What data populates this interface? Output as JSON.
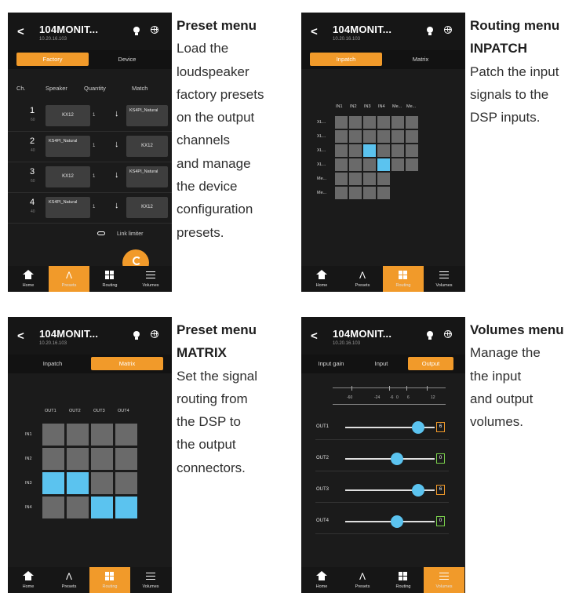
{
  "device": {
    "name": "104MONIT...",
    "ip": "10.20.16.103"
  },
  "nav": [
    "Home",
    "Presets",
    "Routing",
    "Volumes"
  ],
  "icons": {
    "back": "back-chevron-icon",
    "bulb": "bulb-icon",
    "globe": "globe-icon",
    "link": "link-icon",
    "fab": "tools-icon"
  },
  "colors": {
    "accent": "#f19a2a",
    "active_cell": "#5bc3ef",
    "inactive_cell": "#6a6a6a",
    "background": "#1b1b1b"
  },
  "screen1": {
    "tabs": [
      "Factory",
      "Device"
    ],
    "active_tab": 0,
    "headers": {
      "ch": "Ch.",
      "speaker": "Speaker",
      "quantity": "Quantity",
      "match": "Match"
    },
    "rows": [
      {
        "ch": "1",
        "sub": "60",
        "speaker": "KX12",
        "qty": "1",
        "arrow": "↓",
        "match": "KS4PI_Natural"
      },
      {
        "ch": "2",
        "sub": "40",
        "speaker": "KS4PI_Natural",
        "qty": "1",
        "arrow": "↓",
        "match": "KX12"
      },
      {
        "ch": "3",
        "sub": "60",
        "speaker": "KX12",
        "qty": "1",
        "arrow": "↓",
        "match": "KS4PI_Natural"
      },
      {
        "ch": "4",
        "sub": "40",
        "speaker": "KS4PI_Natural",
        "qty": "1",
        "arrow": "↓",
        "match": "KX12"
      }
    ],
    "link_limiter": "Link limiter",
    "active_nav": 1
  },
  "screen2": {
    "tabs": [
      "Inpatch",
      "Matrix"
    ],
    "active_tab": 0,
    "col_labels": [
      "IN1",
      "IN2",
      "IN3",
      "IN4",
      "Me...",
      "Me..."
    ],
    "row_labels": [
      "XL...",
      "XL...",
      "XL...",
      "XL...",
      "Me...",
      "Me..."
    ],
    "active_cells": [
      [
        2,
        2
      ],
      [
        3,
        3
      ]
    ],
    "active_nav": 2
  },
  "screen3": {
    "tabs": [
      "Inpatch",
      "Matrix"
    ],
    "active_tab": 1,
    "col_labels": [
      "OUT1",
      "OUT2",
      "OUT3",
      "OUT4"
    ],
    "row_labels": [
      "IN1",
      "IN2",
      "IN3",
      "IN4"
    ],
    "active_cells": [
      [
        2,
        0
      ],
      [
        2,
        1
      ],
      [
        3,
        2
      ],
      [
        3,
        3
      ]
    ],
    "active_nav": 2
  },
  "screen4": {
    "tabs": [
      "Input gain",
      "Input",
      "Output"
    ],
    "active_tab": 2,
    "scale": [
      "-60",
      "-24",
      "-6",
      "0",
      "6",
      "12"
    ],
    "outputs": [
      {
        "label": "OUT1",
        "value": "6",
        "level": 0.82
      },
      {
        "label": "OUT2",
        "value": "0",
        "level": 0.58
      },
      {
        "label": "OUT3",
        "value": "6",
        "level": 0.82
      },
      {
        "label": "OUT4",
        "value": "0",
        "level": 0.58
      }
    ],
    "active_nav": 3
  },
  "captions": [
    {
      "title": [
        "Preset menu"
      ],
      "body": [
        "Load the",
        "loudspeaker",
        "factory presets",
        "on the output",
        "channels",
        "and manage",
        "the device",
        "configuration",
        "presets."
      ]
    },
    {
      "title": [
        "Routing menu",
        "INPATCH"
      ],
      "body": [
        "Patch the input",
        "signals to the",
        "DSP inputs."
      ]
    },
    {
      "title": [
        "Preset menu",
        "MATRIX"
      ],
      "body": [
        "Set the signal",
        "routing from",
        "the DSP to",
        "the output",
        "connectors."
      ]
    },
    {
      "title": [
        "Volumes menu"
      ],
      "body": [
        "Manage the",
        "the input",
        "and output",
        "volumes."
      ]
    }
  ]
}
